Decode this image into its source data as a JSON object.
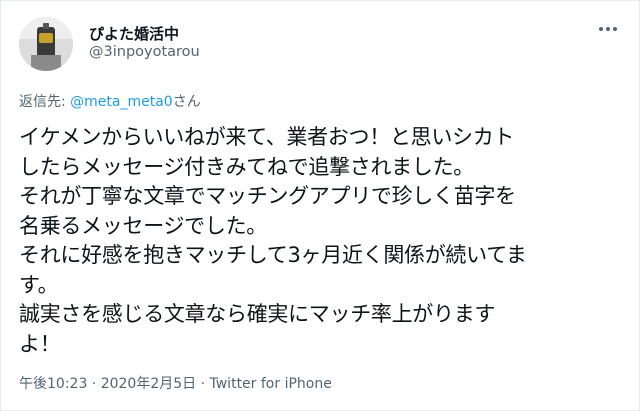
{
  "tweet": {
    "author": {
      "display_name": "ぴよた婚活中",
      "handle": "@3inpoyotarou"
    },
    "reply": {
      "prefix": "返信先: ",
      "mention": "@meta_meta0",
      "suffix": "さん"
    },
    "text_lines": [
      "イケメンからいいねが来て、業者おつ！と思いシカト",
      "したらメッセージ付きみてねで追撃されました。",
      "それが丁寧な文章でマッチングアプリで珍しく苗字を",
      "名乗るメッセージでした。",
      "それに好感を抱きマッチして3ヶ月近く関係が続いてま",
      "す。",
      "誠実さを感じる文章なら確実にマッチ率上がります",
      "よ！"
    ],
    "timestamp": "午後10:23 · 2020年2月5日 · ",
    "source": "Twitter for iPhone"
  },
  "icons": {
    "avatar": "avatar-photo",
    "more": "more-icon"
  },
  "colors": {
    "text_primary": "#0f1419",
    "text_secondary": "#536471",
    "link": "#1d9bf0",
    "border": "#e6ecf0"
  }
}
